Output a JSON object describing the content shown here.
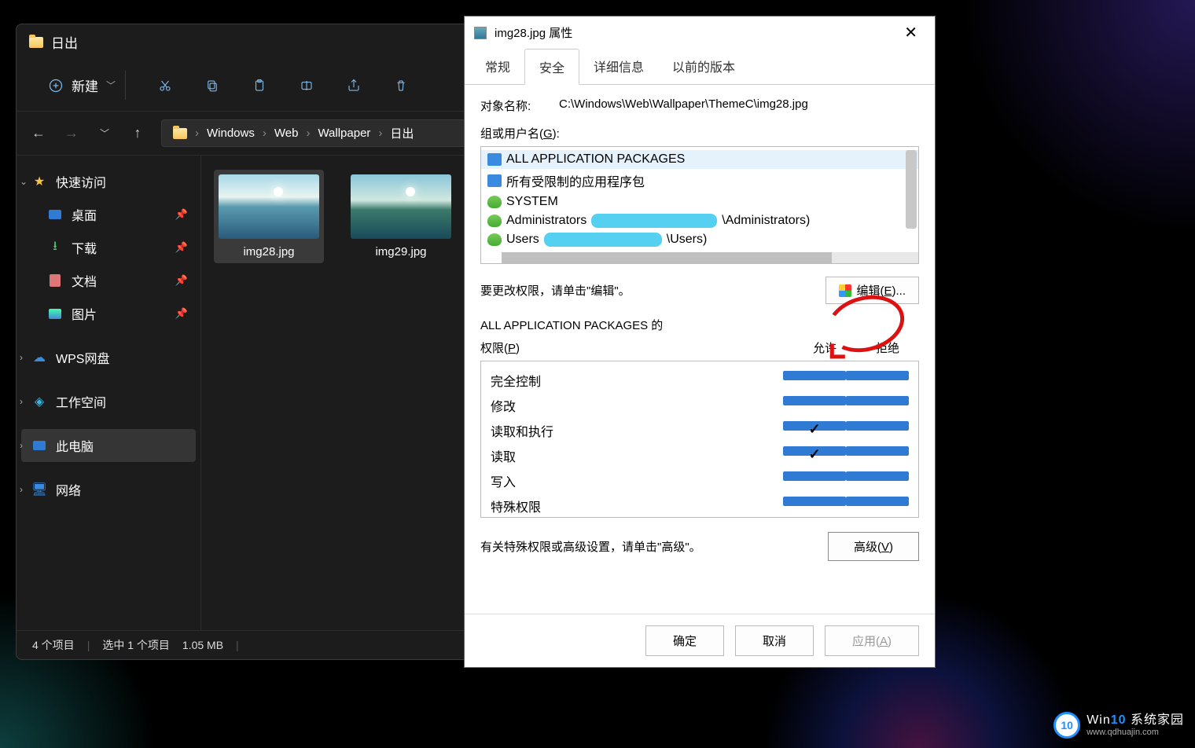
{
  "explorer": {
    "title": "日出",
    "toolbar": {
      "new": "新建"
    },
    "breadcrumbs": [
      "Windows",
      "Web",
      "Wallpaper",
      "日出"
    ],
    "sidebar": {
      "quick": "快速访问",
      "items": [
        {
          "label": "桌面"
        },
        {
          "label": "下载"
        },
        {
          "label": "文档"
        },
        {
          "label": "图片"
        }
      ],
      "wps": "WPS网盘",
      "workspace": "工作空间",
      "thispc": "此电脑",
      "network": "网络"
    },
    "files": [
      {
        "name": "img28.jpg",
        "selected": true
      },
      {
        "name": "img29.jpg",
        "selected": false
      }
    ],
    "status": {
      "count": "4 个项目",
      "selected": "选中 1 个项目",
      "size": "1.05 MB"
    }
  },
  "dialog": {
    "title": "img28.jpg 属性",
    "tabs": [
      "常规",
      "安全",
      "详细信息",
      "以前的版本"
    ],
    "active_tab": 1,
    "object_label": "对象名称:",
    "object_path": "C:\\Windows\\Web\\Wallpaper\\ThemeC\\img28.jpg",
    "group_label_pre": "组或用户名(",
    "group_label_u": "G",
    "group_label_post": "):",
    "users": [
      {
        "name": "ALL APPLICATION PACKAGES",
        "icon": "pkg",
        "selected": true
      },
      {
        "name": "所有受限制的应用程序包",
        "icon": "pkg"
      },
      {
        "name": "SYSTEM",
        "icon": "grp"
      },
      {
        "name_pre": "Administrators ",
        "name_post": "\\Administrators)",
        "icon": "grp",
        "redact": 160
      },
      {
        "name_pre": "Users ",
        "name_post": "\\Users)",
        "icon": "grp",
        "redact": 150
      }
    ],
    "edit_hint": "要更改权限，请单击\"编辑\"。",
    "edit_btn_pre": "编辑(",
    "edit_btn_u": "E",
    "edit_btn_post": ")...",
    "perm_title_1": "ALL APPLICATION PACKAGES 的",
    "perm_title_2_pre": "权限(",
    "perm_title_2_u": "P",
    "perm_title_2_post": ")",
    "allow": "允许",
    "deny": "拒绝",
    "perms": [
      {
        "name": "完全控制",
        "allow": false
      },
      {
        "name": "修改",
        "allow": false
      },
      {
        "name": "读取和执行",
        "allow": true
      },
      {
        "name": "读取",
        "allow": true
      },
      {
        "name": "写入",
        "allow": false
      },
      {
        "name": "特殊权限",
        "allow": false
      }
    ],
    "adv_hint": "有关特殊权限或高级设置，请单击\"高级\"。",
    "adv_btn_pre": "高级(",
    "adv_btn_u": "V",
    "adv_btn_post": ")",
    "buttons": {
      "ok": "确定",
      "cancel": "取消",
      "apply_pre": "应用(",
      "apply_u": "A",
      "apply_post": ")"
    }
  },
  "watermark": {
    "logo": "10",
    "brand_pre": "Win",
    "brand_b": "10",
    "brand_post": " 系统家园",
    "url": "www.qdhuajin.com"
  }
}
